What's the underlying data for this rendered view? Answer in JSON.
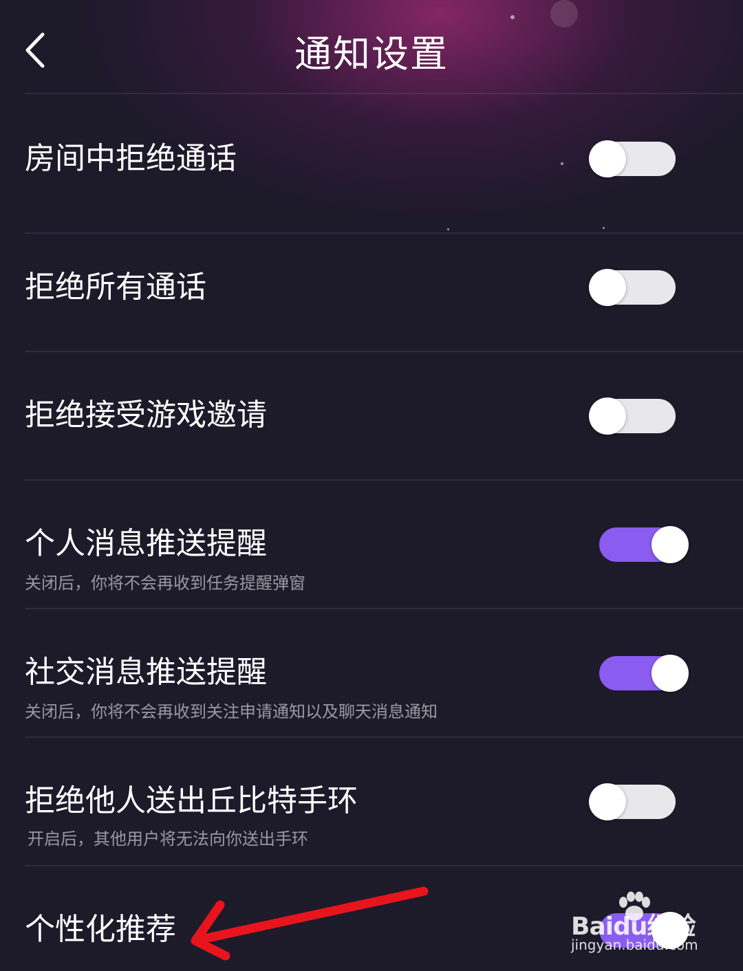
{
  "colors": {
    "background": "#1d1a2a",
    "toggle_on": "#8a5cf0",
    "annotation": "#e8141c"
  },
  "header": {
    "back_icon": "chevron-left-icon",
    "title": "通知设置"
  },
  "settings": [
    {
      "label": "房间中拒绝通话",
      "description": "",
      "enabled": false
    },
    {
      "label": "拒绝所有通话",
      "description": "",
      "enabled": false
    },
    {
      "label": "拒绝接受游戏邀请",
      "description": "",
      "enabled": false
    },
    {
      "label": "个人消息推送提醒",
      "description": "关闭后，你将不会再收到任务提醒弹窗",
      "enabled": true
    },
    {
      "label": "社交消息推送提醒",
      "description": "关闭后，你将不会再收到关注申请通知以及聊天消息通知",
      "enabled": true
    },
    {
      "label": "拒绝他人送出丘比特手环",
      "description": "开启后，其他用户将无法向你送出手环",
      "enabled": false
    },
    {
      "label": "个性化推荐",
      "description": "",
      "enabled": true
    }
  ],
  "watermark": {
    "brand": "Baidu经验",
    "url": "jingyan.baidu.com"
  }
}
